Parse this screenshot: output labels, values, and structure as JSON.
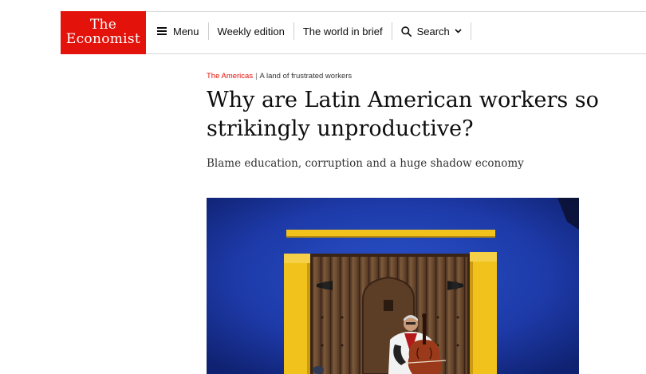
{
  "header": {
    "logo": {
      "line1": "The",
      "line2": "Economist"
    },
    "nav": {
      "menu_label": "Menu",
      "weekly_label": "Weekly edition",
      "brief_label": "The world in brief",
      "search_label": "Search"
    }
  },
  "article": {
    "section": "The Americas",
    "separator": "|",
    "rubric": "A land of frustrated workers",
    "headline": "Why are Latin American workers so strikingly unproductive?",
    "subhead": "Blame education, corruption and a huge shadow economy"
  },
  "colors": {
    "brand_red": "#e3120b",
    "wall_blue": "#1f3fb0",
    "frame_yellow": "#f1c21b",
    "door_brown": "#6b4a2e"
  }
}
